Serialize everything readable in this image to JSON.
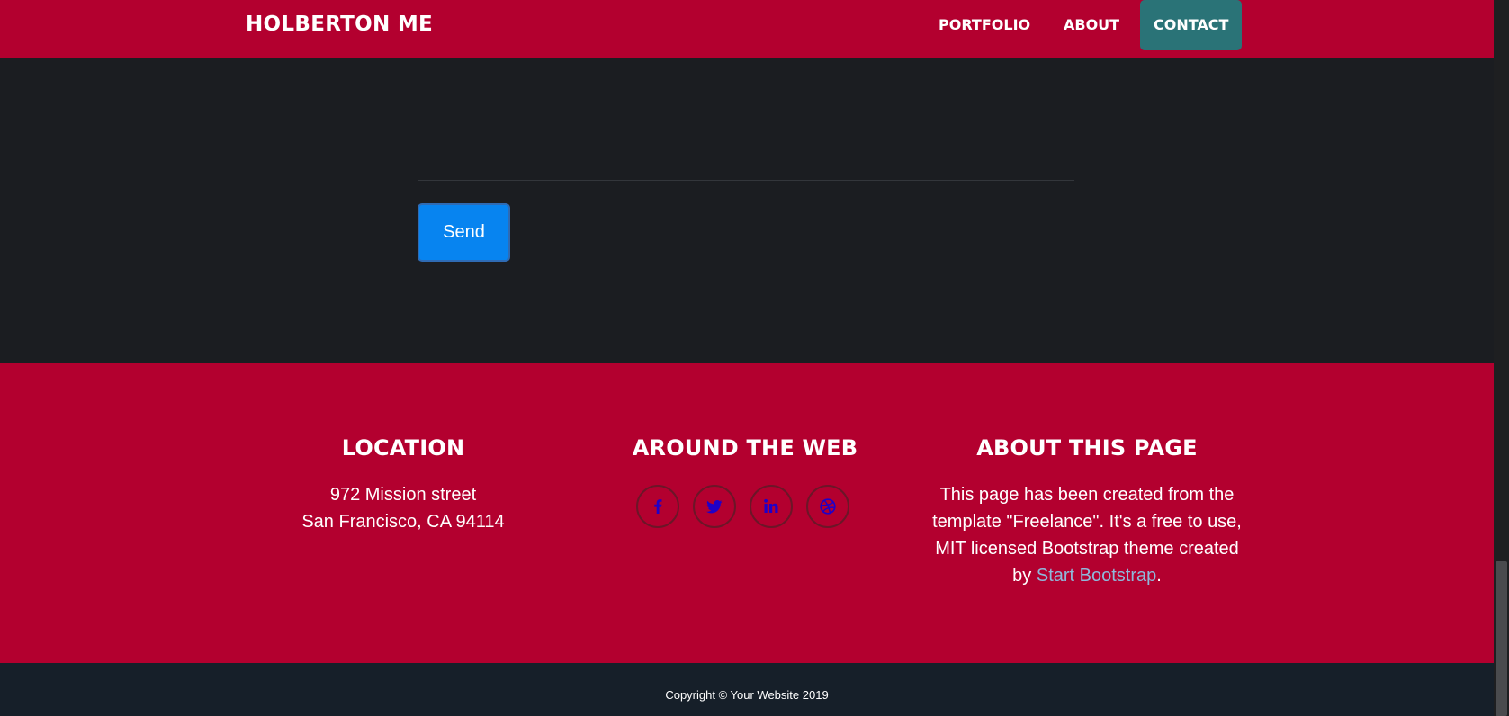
{
  "navbar": {
    "brand": "HOLBERTON ME",
    "links": [
      "PORTFOLIO",
      "ABOUT",
      "CONTACT"
    ],
    "active": "CONTACT"
  },
  "contact": {
    "send_label": "Send"
  },
  "footer": {
    "location": {
      "heading": "LOCATION",
      "lines": [
        "972 Mission street",
        "San Francisco, CA 94114"
      ]
    },
    "web": {
      "heading": "AROUND THE WEB",
      "icons": [
        "facebook-icon",
        "twitter-icon",
        "linkedin-icon",
        "dribbble-icon"
      ]
    },
    "about": {
      "heading": "ABOUT THIS PAGE",
      "text": "This page has been created from the template \"Freelance\". It's a free to use, MIT licensed Bootstrap theme created by ",
      "link_text": "Start Bootstrap",
      "trailing": "."
    }
  },
  "copyright": "Copyright © Your Website 2019",
  "colors": {
    "primary": "#b3002f",
    "active_nav": "#2a7377",
    "send_button": "#0784f0",
    "dark_bg": "#1b1d21",
    "copyright_bg": "#161f29",
    "link": "#8fb9db",
    "icon": "#1f00c8"
  }
}
